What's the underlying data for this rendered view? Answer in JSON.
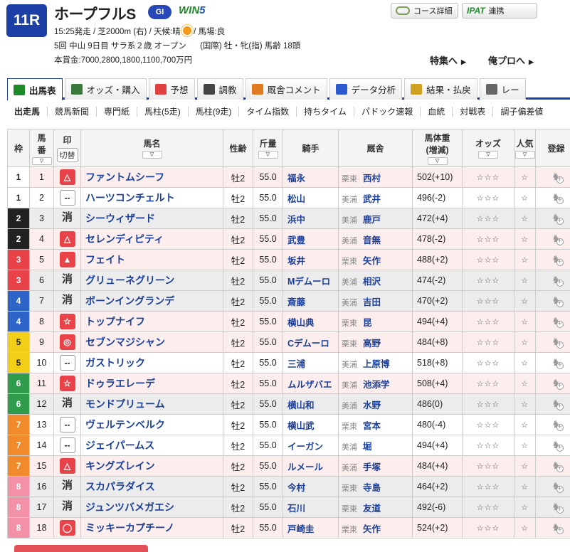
{
  "race": {
    "number": "11R",
    "name": "ホープフルS",
    "grade": "GI",
    "win5": "WIN",
    "win5_num": "5",
    "info1_a": "15:25発走 / 芝2000m (右) / 天候:晴",
    "info1_b": "/ 馬場:良",
    "info2": "5回 中山 9日目 サラ系２歳 オープン",
    "info2_b": "(国際) 牡・牝(指) 馬齢 18頭",
    "info3": "本賞金:7000,2800,1800,1100,700万円"
  },
  "top_buttons": {
    "course": "コース詳細",
    "ipat": "IPAT",
    "ipat_sub": "連携"
  },
  "top_links": {
    "feature": "特集へ",
    "orepro": "俺プロへ",
    "arrow": "▶"
  },
  "tabs": [
    {
      "label": "出馬表",
      "icon": "#1d8a2a"
    },
    {
      "label": "オッズ・購入",
      "icon": "#3a7a3a"
    },
    {
      "label": "予想",
      "icon": "#e04040"
    },
    {
      "label": "調教",
      "icon": "#444"
    },
    {
      "label": "厩舎コメント",
      "icon": "#e07a20"
    },
    {
      "label": "データ分析",
      "icon": "#2c5bd0"
    },
    {
      "label": "結果・払戻",
      "icon": "#d0a020"
    },
    {
      "label": "レー",
      "icon": "#666"
    }
  ],
  "subtabs": [
    "出走馬",
    "競馬新聞",
    "専門紙",
    "馬柱(5走)",
    "馬柱(9走)",
    "タイム指数",
    "持ちタイム",
    "パドック速報",
    "血統",
    "対戦表",
    "調子偏差値"
  ],
  "headers": {
    "waku": "枠",
    "umaban1": "馬",
    "umaban2": "番",
    "mark1": "印",
    "mark2": "切替",
    "name": "馬名",
    "sexage": "性齢",
    "kinryo1": "斤",
    "kinryo2": "量",
    "jockey": "騎手",
    "trainer": "厩舎",
    "weight1": "馬体重",
    "weight2": "(増減)",
    "odds": "オッズ",
    "pop1": "人",
    "pop2": "気",
    "reg": "登録",
    "sort": "▽"
  },
  "waku_colors": {
    "1": [
      "#ffffff",
      "#222"
    ],
    "2": [
      "#222222",
      "#fff"
    ],
    "3": [
      "#e94349",
      "#fff"
    ],
    "4": [
      "#2e63c8",
      "#fff"
    ],
    "5": [
      "#f3cf17",
      "#222"
    ],
    "6": [
      "#2e9c4a",
      "#fff"
    ],
    "7": [
      "#f08a2a",
      "#fff"
    ],
    "8": [
      "#f391a8",
      "#fff"
    ]
  },
  "horses": [
    {
      "waku": "1",
      "num": "1",
      "mark": "△",
      "markType": "red",
      "name": "ファントムシーフ",
      "sexage": "牡2",
      "kinryo": "55.0",
      "jockey": "福永",
      "area": "栗東",
      "trainer": "西村",
      "weight": "502(+10)",
      "odds": "☆☆☆",
      "pop": "☆",
      "row": "pink"
    },
    {
      "waku": "1",
      "num": "2",
      "mark": "--",
      "markType": "plain",
      "name": "ハーツコンチェルト",
      "sexage": "牡2",
      "kinryo": "55.0",
      "jockey": "松山",
      "area": "美浦",
      "trainer": "武井",
      "weight": "496(-2)",
      "odds": "☆☆☆",
      "pop": "☆",
      "row": "white"
    },
    {
      "waku": "2",
      "num": "3",
      "mark": "消",
      "markType": "kesu",
      "name": "シーウィザード",
      "sexage": "牡2",
      "kinryo": "55.0",
      "jockey": "浜中",
      "area": "美浦",
      "trainer": "鹿戸",
      "weight": "472(+4)",
      "odds": "☆☆☆",
      "pop": "☆",
      "row": "gray"
    },
    {
      "waku": "2",
      "num": "4",
      "mark": "△",
      "markType": "red",
      "name": "セレンディピティ",
      "sexage": "牡2",
      "kinryo": "55.0",
      "jockey": "武豊",
      "area": "美浦",
      "trainer": "音無",
      "weight": "478(-2)",
      "odds": "☆☆☆",
      "pop": "☆",
      "row": "pink"
    },
    {
      "waku": "3",
      "num": "5",
      "mark": "▲",
      "markType": "red",
      "name": "フェイト",
      "sexage": "牡2",
      "kinryo": "55.0",
      "jockey": "坂井",
      "area": "栗東",
      "trainer": "矢作",
      "weight": "488(+2)",
      "odds": "☆☆☆",
      "pop": "☆",
      "row": "pink"
    },
    {
      "waku": "3",
      "num": "6",
      "mark": "消",
      "markType": "kesu",
      "name": "グリューネグリーン",
      "sexage": "牡2",
      "kinryo": "55.0",
      "jockey": "Mデムーロ",
      "area": "美浦",
      "trainer": "相沢",
      "weight": "474(-2)",
      "odds": "☆☆☆",
      "pop": "☆",
      "row": "gray"
    },
    {
      "waku": "4",
      "num": "7",
      "mark": "消",
      "markType": "kesu",
      "name": "ボーンイングランデ",
      "sexage": "牡2",
      "kinryo": "55.0",
      "jockey": "斎藤",
      "area": "美浦",
      "trainer": "吉田",
      "weight": "470(+2)",
      "odds": "☆☆☆",
      "pop": "☆",
      "row": "gray"
    },
    {
      "waku": "4",
      "num": "8",
      "mark": "☆",
      "markType": "red",
      "name": "トップナイフ",
      "sexage": "牡2",
      "kinryo": "55.0",
      "jockey": "横山典",
      "area": "栗東",
      "trainer": "昆",
      "weight": "494(+4)",
      "odds": "☆☆☆",
      "pop": "☆",
      "row": "pink"
    },
    {
      "waku": "5",
      "num": "9",
      "mark": "◎",
      "markType": "red",
      "name": "セブンマジシャン",
      "sexage": "牡2",
      "kinryo": "55.0",
      "jockey": "Cデムーロ",
      "area": "栗東",
      "trainer": "高野",
      "weight": "484(+8)",
      "odds": "☆☆☆",
      "pop": "☆",
      "row": "pink"
    },
    {
      "waku": "5",
      "num": "10",
      "mark": "--",
      "markType": "plain",
      "name": "ガストリック",
      "sexage": "牡2",
      "kinryo": "55.0",
      "jockey": "三浦",
      "area": "美浦",
      "trainer": "上原博",
      "weight": "518(+8)",
      "odds": "☆☆☆",
      "pop": "☆",
      "row": "white"
    },
    {
      "waku": "6",
      "num": "11",
      "mark": "☆",
      "markType": "red",
      "name": "ドゥラエレーデ",
      "sexage": "牡2",
      "kinryo": "55.0",
      "jockey": "ムルザバエ",
      "area": "美浦",
      "trainer": "池添学",
      "weight": "508(+4)",
      "odds": "☆☆☆",
      "pop": "☆",
      "row": "pink"
    },
    {
      "waku": "6",
      "num": "12",
      "mark": "消",
      "markType": "kesu",
      "name": "モンドプリューム",
      "sexage": "牡2",
      "kinryo": "55.0",
      "jockey": "横山和",
      "area": "美浦",
      "trainer": "水野",
      "weight": "486(0)",
      "odds": "☆☆☆",
      "pop": "☆",
      "row": "gray"
    },
    {
      "waku": "7",
      "num": "13",
      "mark": "--",
      "markType": "plain",
      "name": "ヴェルテンベルク",
      "sexage": "牡2",
      "kinryo": "55.0",
      "jockey": "横山武",
      "area": "栗東",
      "trainer": "宮本",
      "weight": "480(-4)",
      "odds": "☆☆☆",
      "pop": "☆",
      "row": "white"
    },
    {
      "waku": "7",
      "num": "14",
      "mark": "--",
      "markType": "plain",
      "name": "ジェイパームス",
      "sexage": "牡2",
      "kinryo": "55.0",
      "jockey": "イーガン",
      "area": "美浦",
      "trainer": "堀",
      "weight": "494(+4)",
      "odds": "☆☆☆",
      "pop": "☆",
      "row": "white"
    },
    {
      "waku": "7",
      "num": "15",
      "mark": "△",
      "markType": "red",
      "name": "キングズレイン",
      "sexage": "牡2",
      "kinryo": "55.0",
      "jockey": "ルメール",
      "area": "美浦",
      "trainer": "手塚",
      "weight": "484(+4)",
      "odds": "☆☆☆",
      "pop": "☆",
      "row": "pink"
    },
    {
      "waku": "8",
      "num": "16",
      "mark": "消",
      "markType": "kesu",
      "name": "スカパラダイス",
      "sexage": "牡2",
      "kinryo": "55.0",
      "jockey": "今村",
      "area": "栗東",
      "trainer": "寺島",
      "weight": "464(+2)",
      "odds": "☆☆☆",
      "pop": "☆",
      "row": "gray"
    },
    {
      "waku": "8",
      "num": "17",
      "mark": "消",
      "markType": "kesu",
      "name": "ジュンツバメガエシ",
      "sexage": "牡2",
      "kinryo": "55.0",
      "jockey": "石川",
      "area": "栗東",
      "trainer": "友道",
      "weight": "492(-6)",
      "odds": "☆☆☆",
      "pop": "☆",
      "row": "gray"
    },
    {
      "waku": "8",
      "num": "18",
      "mark": "◯",
      "markType": "red",
      "name": "ミッキーカプチーノ",
      "sexage": "牡2",
      "kinryo": "55.0",
      "jockey": "戸崎圭",
      "area": "栗東",
      "trainer": "矢作",
      "weight": "524(+2)",
      "odds": "☆☆☆",
      "pop": "☆",
      "row": "pink"
    }
  ]
}
